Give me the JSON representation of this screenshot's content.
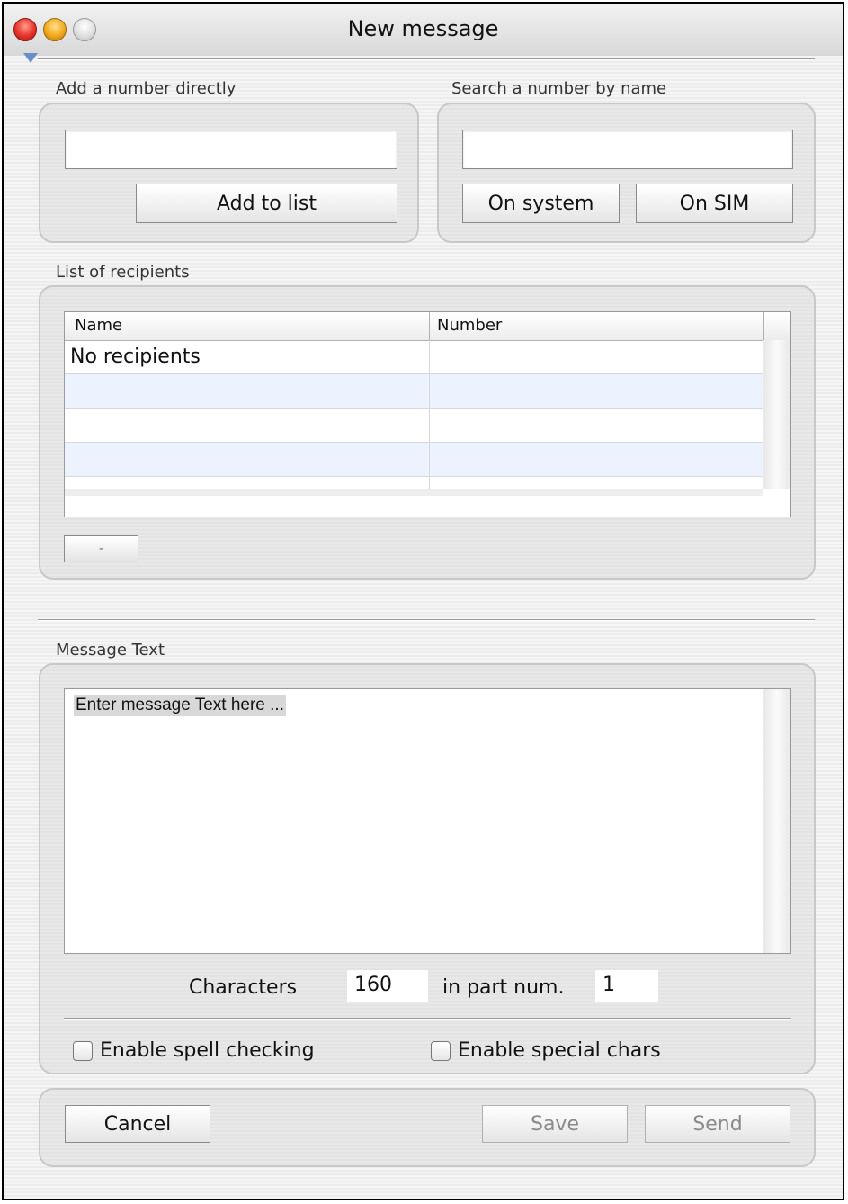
{
  "window": {
    "title": "New message"
  },
  "add_direct": {
    "label": "Add a number directly",
    "input_value": "",
    "add_button": "Add to list"
  },
  "search": {
    "label": "Search a number by name",
    "input_value": "",
    "system_button": "On system",
    "sim_button": "On SIM"
  },
  "recipients": {
    "label": "List of recipients",
    "columns": [
      "Name",
      "Number"
    ],
    "rows": [
      {
        "name": "No recipients",
        "number": ""
      },
      {
        "name": "",
        "number": ""
      },
      {
        "name": "",
        "number": ""
      },
      {
        "name": "",
        "number": ""
      }
    ],
    "remove_button": "-"
  },
  "message": {
    "label": "Message Text",
    "text": "Enter message Text here ...",
    "characters_label": "Characters",
    "characters_value": "160",
    "part_label": "in part num.",
    "part_value": "1"
  },
  "options": {
    "spell_checking": {
      "label": "Enable spell checking",
      "checked": false
    },
    "special_chars": {
      "label": "Enable special chars",
      "checked": false
    }
  },
  "actions": {
    "cancel": "Cancel",
    "save": "Save",
    "send": "Send"
  }
}
